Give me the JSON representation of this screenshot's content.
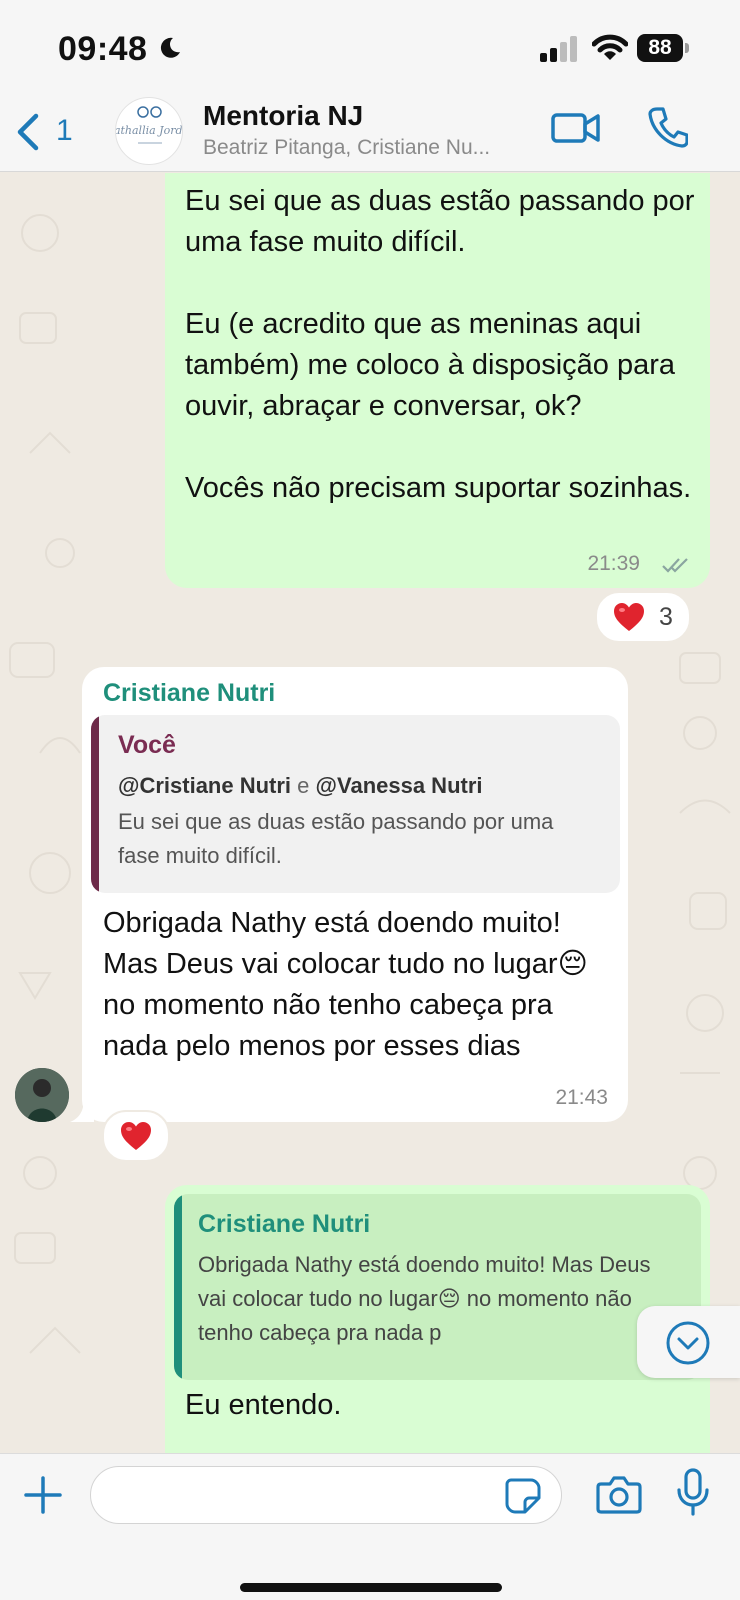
{
  "status_bar": {
    "time": "09:48",
    "battery": "88"
  },
  "header": {
    "back_count": "1",
    "title": "Mentoria NJ",
    "subtitle": "Beatriz Pitanga, Cristiane Nu...",
    "avatar_text": "Nathallia Jordão"
  },
  "messages": [
    {
      "direction": "outgoing",
      "text": "Eu sei que as duas estão passando por uma fase muito difícil.\n\nEu (e acredito que as meninas aqui também) me coloco à disposição para ouvir, abraçar e conversar, ok?\n\nVocês não precisam suportar sozinhas.",
      "time": "21:39",
      "reaction": {
        "emoji": "heart",
        "count": "3"
      }
    },
    {
      "direction": "incoming",
      "sender": "Cristiane Nutri",
      "quote": {
        "author": "Você",
        "mention_a": "@Cristiane Nutri",
        "mention_joiner": "e",
        "mention_b": "@Vanessa Nutri",
        "text": "Eu sei que as duas estão passando por uma fase muito difícil."
      },
      "text": "Obrigada Nathy está doendo muito! Mas Deus vai colocar tudo no lugar😔 no momento não tenho cabeça pra nada pelo menos por esses dias",
      "time": "21:43",
      "reaction": {
        "emoji": "heart"
      }
    },
    {
      "direction": "outgoing",
      "quote": {
        "author": "Cristiane Nutri",
        "text": "Obrigada Nathy está doendo muito! Mas Deus vai colocar tudo no lugar😔 no momento não tenho cabeça pra nada p"
      },
      "text": "Eu entendo."
    }
  ],
  "composer": {
    "placeholder": ""
  },
  "colors": {
    "outgoing_bubble": "#d9fdd3",
    "incoming_bubble": "#ffffff",
    "chat_bg": "#efeae2",
    "accent_blue": "#1e7ab8",
    "sender_green": "#1f8f7b",
    "quote_author_maroon": "#7a2c52"
  },
  "icons": [
    "moon-icon",
    "signal-icon",
    "wifi-icon",
    "back-chevron-icon",
    "video-call-icon",
    "phone-icon",
    "double-check-icon",
    "heart-icon",
    "chevron-down-icon",
    "plus-icon",
    "sticker-icon",
    "camera-icon",
    "microphone-icon"
  ]
}
